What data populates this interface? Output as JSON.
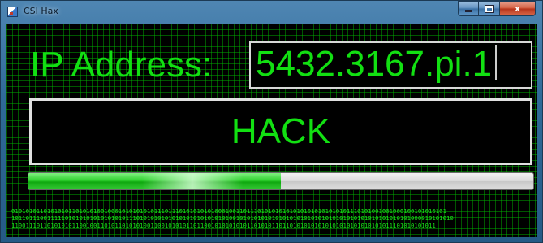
{
  "window": {
    "title": "CSI Hax",
    "minimize_icon": "minimize-icon",
    "maximize_icon": "maximize-icon",
    "close_label": "x"
  },
  "form": {
    "ip_label": "IP Address:",
    "ip_value": "5432.3167.pi.1",
    "hack_label": "HACK",
    "progress": 0.5
  },
  "binary_lines": [
    "01010101101010101101010100100010101010101110111010101010100010011011101010101010101010101010101110101001001000100101010101",
    "1011011100111110101010101010101011101010101010101010101010101001010101010101010101010101010101010101010101010101000010101010",
    "11001110110101010110010011010110101010011001010101101100101010101011010101101101010101010101010101010101011101010101011"
  ],
  "colors": {
    "text_green": "#12e012",
    "grid_green": "#00be00",
    "background": "#000000"
  }
}
